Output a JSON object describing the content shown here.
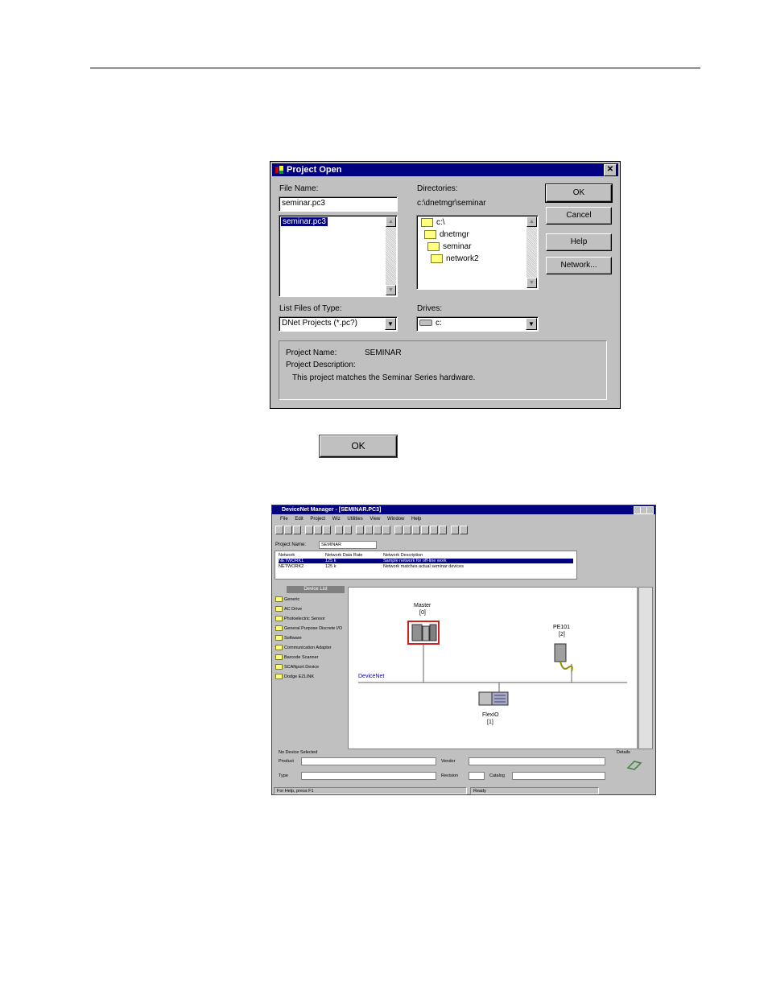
{
  "dialog": {
    "title": "Project Open",
    "close": "✕",
    "file_name_label": "File Name:",
    "file_name_value": "seminar.pc3",
    "files": [
      "seminar.pc3"
    ],
    "directories_label": "Directories:",
    "directories_path": "c:\\dnetmgr\\seminar",
    "dirs": [
      "c:\\",
      "dnetmgr",
      "seminar",
      "network2"
    ],
    "buttons": {
      "ok": "OK",
      "cancel": "Cancel",
      "help": "Help",
      "network": "Network..."
    },
    "list_type_label": "List Files of Type:",
    "list_type_value": "DNet Projects (*.pc?)",
    "drives_label": "Drives:",
    "drives_value": "c:",
    "project_name_label": "Project Name:",
    "project_name_value": "SEMINAR",
    "project_desc_label": "Project Description:",
    "project_desc_value": "This project matches the Seminar Series hardware."
  },
  "ok_button": "OK",
  "devicenet_manager": {
    "title": "DeviceNet Manager - [SEMINAR.PC3]",
    "menu": [
      "File",
      "Edit",
      "Project",
      "Wiz",
      "Utilities",
      "View",
      "Window",
      "Help"
    ],
    "project_name_label": "Project Name:",
    "project_name_value": "SEMINAR",
    "network_headers": [
      "Network",
      "Network Data Rate",
      "Network Description"
    ],
    "networks": [
      {
        "name": "NETWORK1",
        "rate": "125 k",
        "desc": "Sample network for off-line work"
      },
      {
        "name": "NETWORK2",
        "rate": "125 k",
        "desc": "Network matches actual seminar devices"
      }
    ],
    "device_list_title": "Device List",
    "device_list": [
      "Generic",
      "AC Drive",
      "Photoelectric Sensor",
      "General Purpose Discrete I/O",
      "Software",
      "Communication Adapter",
      "Barcode Scanner",
      "SCANport Device",
      "Dodge EZLINK"
    ],
    "diagram": {
      "network_label": "DeviceNet",
      "nodes": [
        {
          "name": "Master",
          "address": "[0]"
        },
        {
          "name": "PE101",
          "address": "[2]"
        },
        {
          "name": "FlexIO",
          "address": "[1]"
        }
      ]
    },
    "status_caption": "No Device Selected",
    "product_label": "Product",
    "vendor_label": "Vendor",
    "type_label": "Type",
    "revision_label": "Revision",
    "catalog_label": "Catalog",
    "details_label": "Details",
    "statusbar_help": "For Help, press F1",
    "statusbar_ready": "Ready"
  }
}
